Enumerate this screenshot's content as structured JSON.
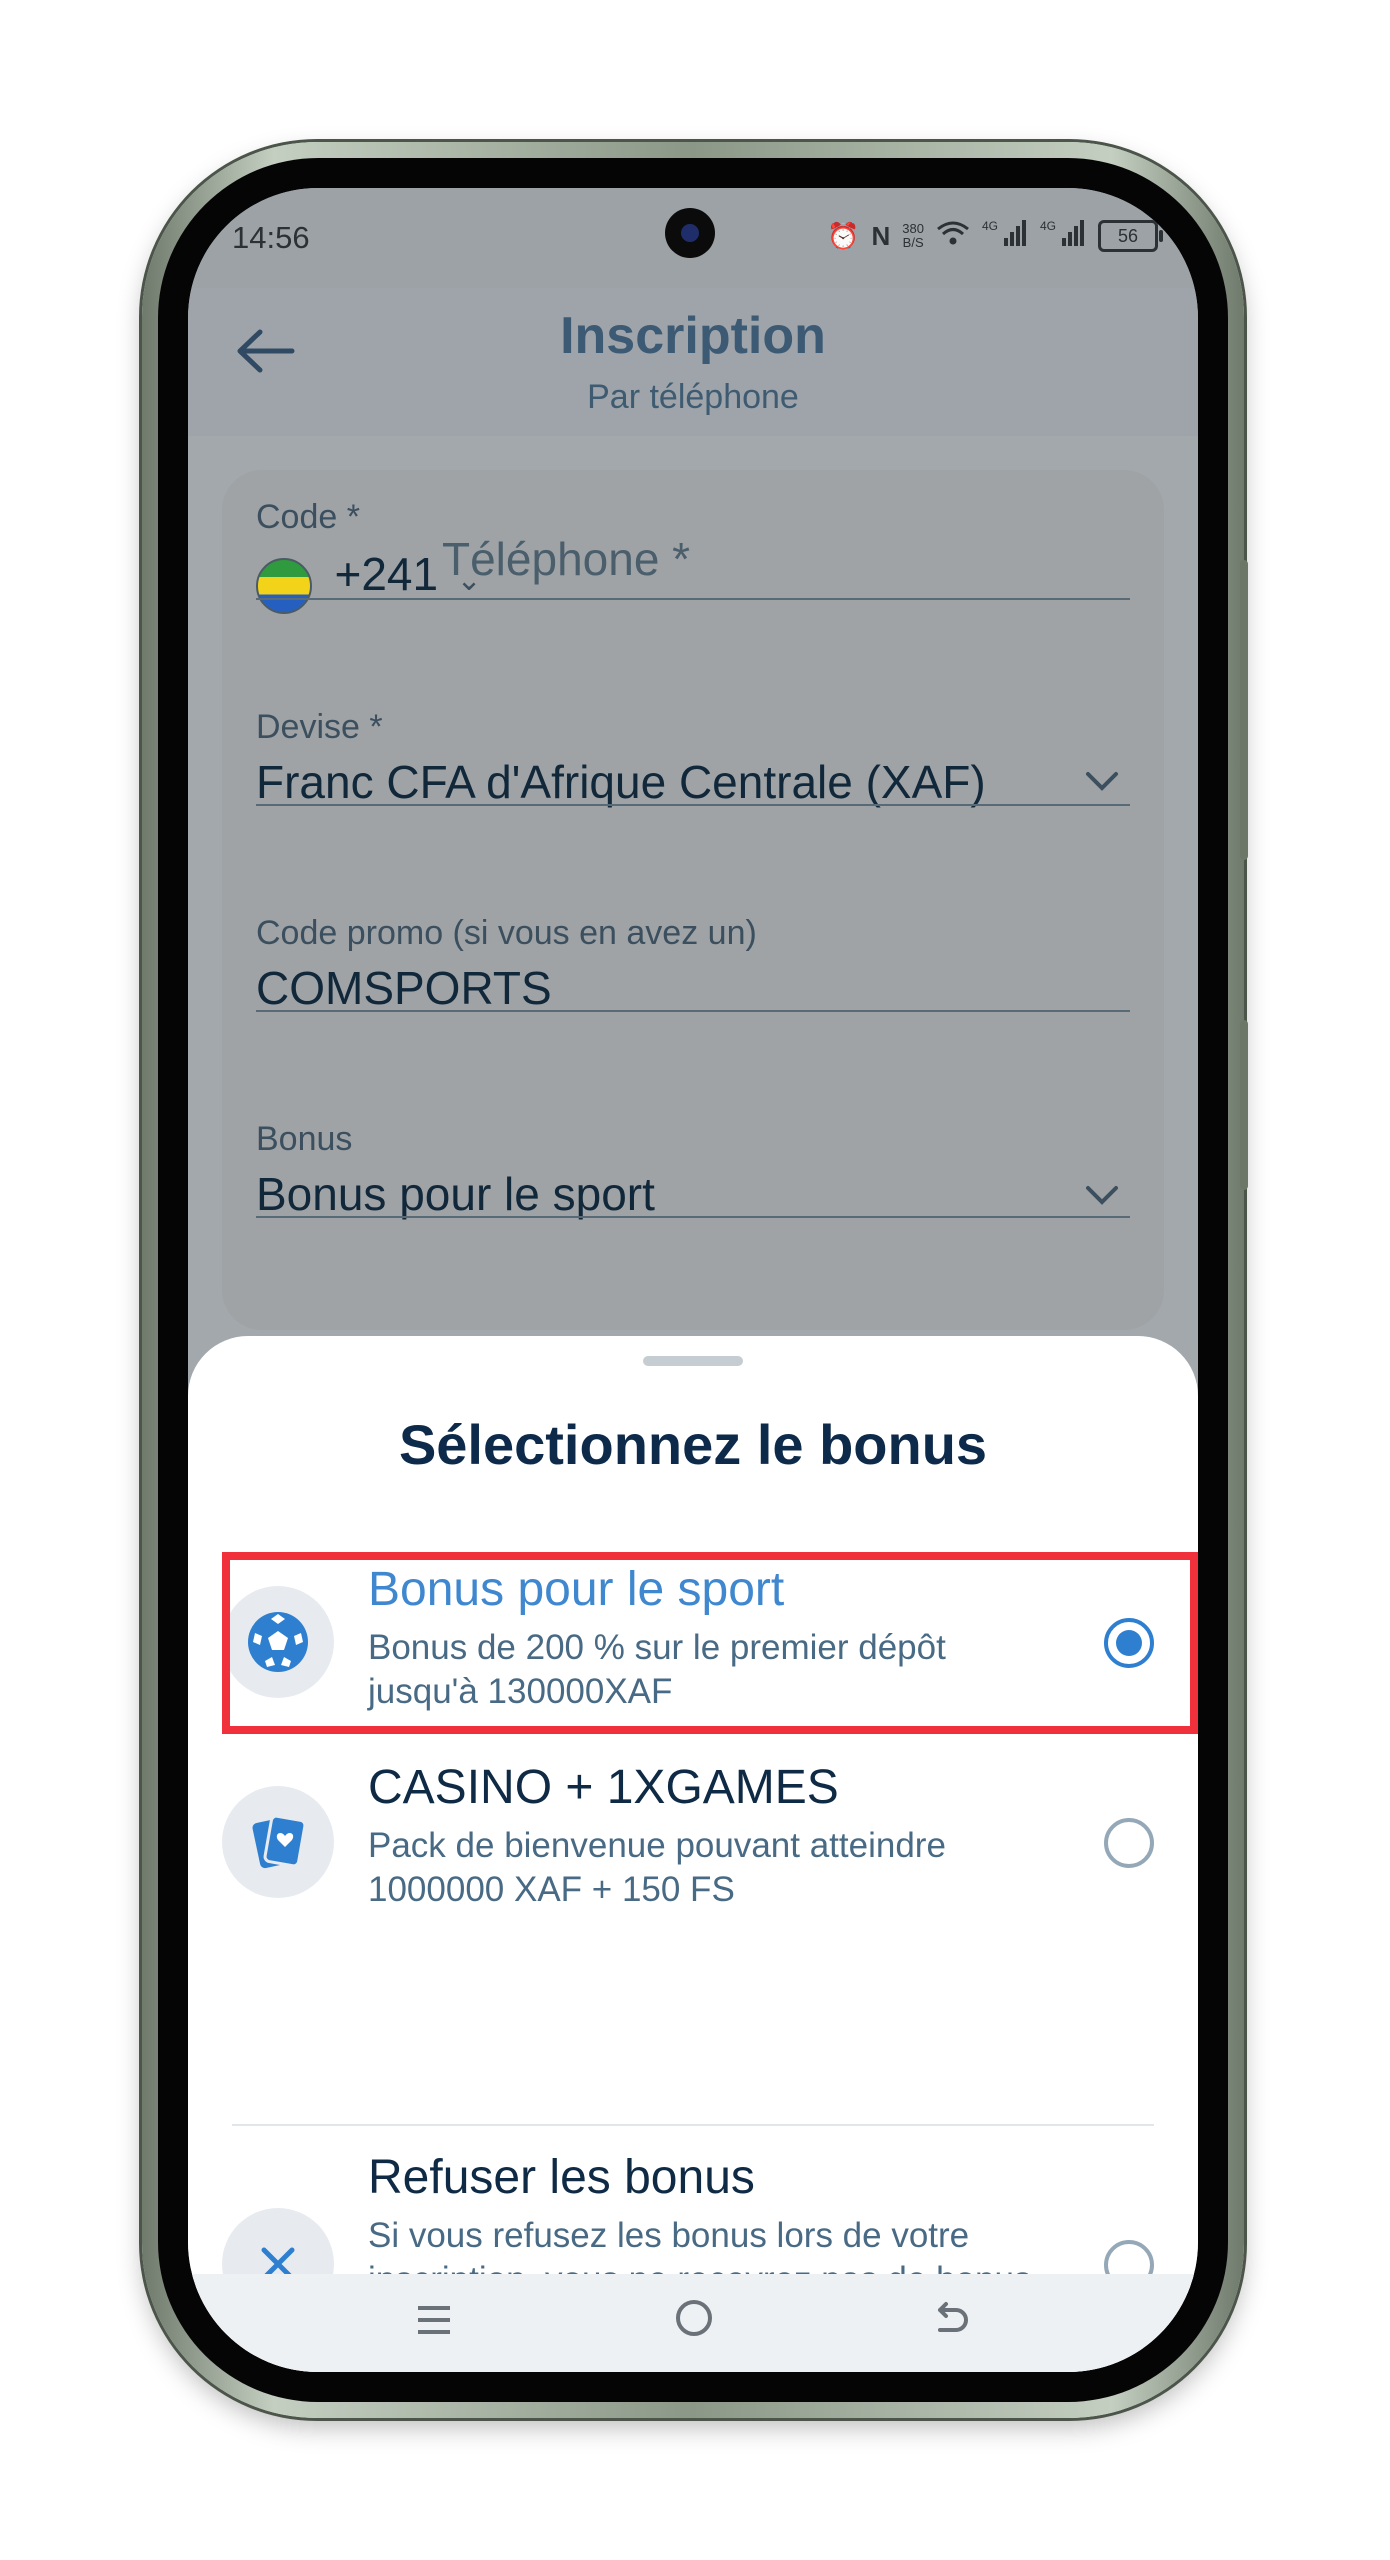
{
  "status": {
    "time": "14:56",
    "speed": "380\nB/S",
    "battery": "56"
  },
  "header": {
    "title": "Inscription",
    "subtitle": "Par téléphone"
  },
  "form": {
    "code_label": "Code *",
    "code_value": "+241",
    "phone_placeholder": "Téléphone *",
    "currency_label": "Devise *",
    "currency_value": "Franc CFA d'Afrique Centrale (XAF)",
    "promo_label": "Code promo (si vous en avez un)",
    "promo_value": "COMSPORTS",
    "bonus_label": "Bonus",
    "bonus_value": "Bonus pour le sport"
  },
  "sheet": {
    "title": "Sélectionnez le bonus",
    "options": [
      {
        "title": "Bonus pour le sport",
        "desc": "Bonus de 200 % sur le premier dépôt jusqu'à 130000XAF",
        "icon": "soccer-ball-icon",
        "selected": true
      },
      {
        "title": "CASINO + 1XGAMES",
        "desc": "Pack de bienvenue pouvant atteindre 1000000 XAF + 150 FS",
        "icon": "playing-card-icon",
        "selected": false
      },
      {
        "title": "Refuser les bonus",
        "desc": "Si vous refusez les bonus lors de votre inscription, vous ne recevrez pas de bonus après avoir effectué votre premier dépôt.",
        "icon": "close-icon",
        "selected": false
      }
    ]
  },
  "colors": {
    "accent": "#2f7fd0",
    "highlight": "#f0313b",
    "title": "#0d2a4a"
  }
}
